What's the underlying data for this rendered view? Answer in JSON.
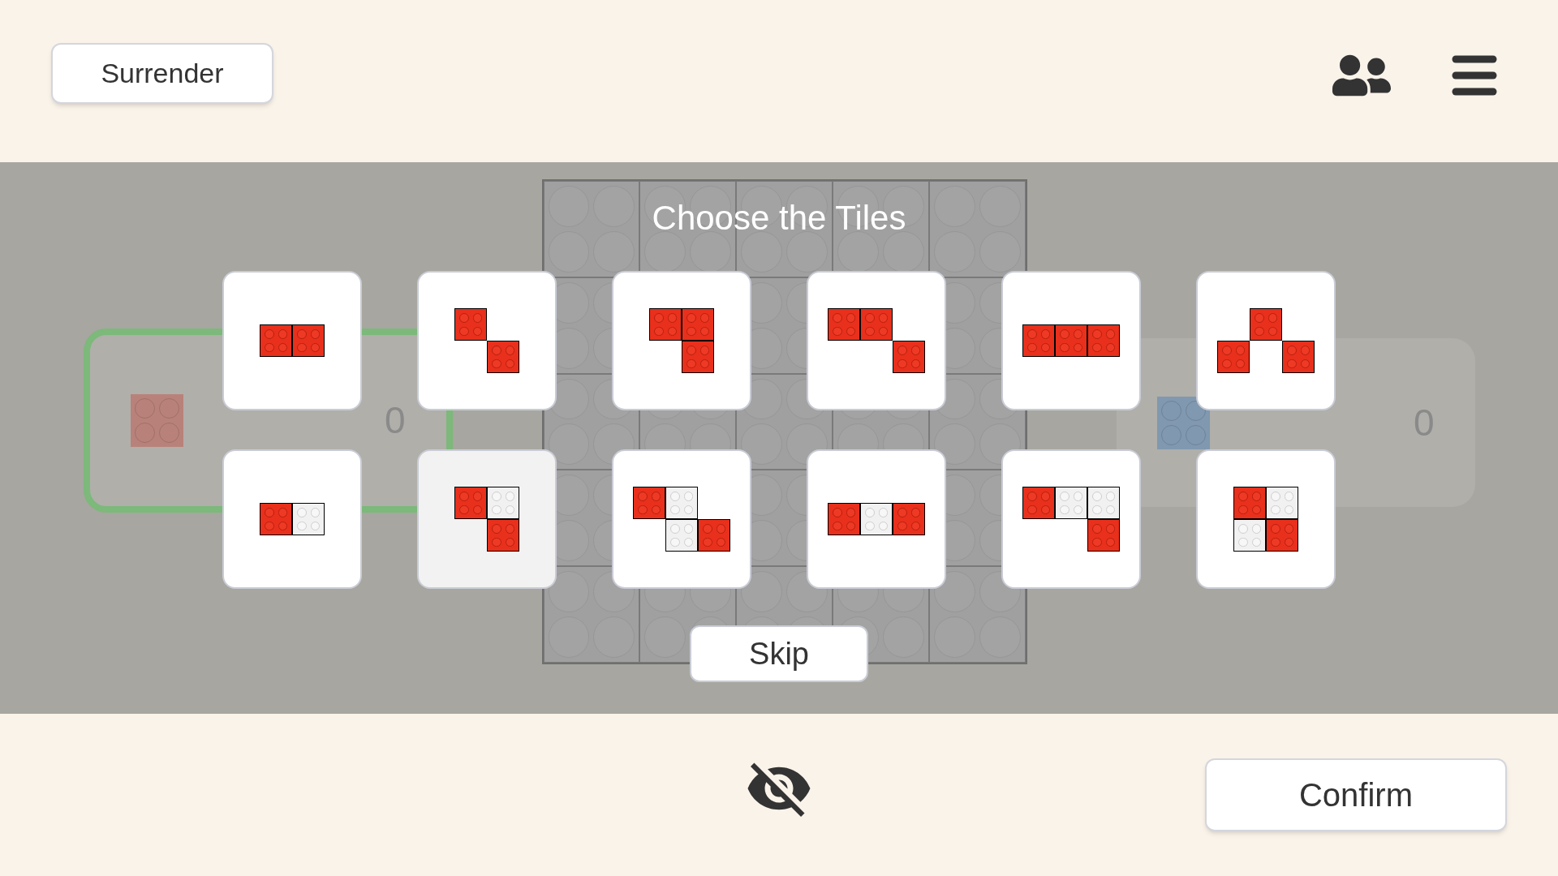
{
  "header": {
    "surrender_button": "Surrender"
  },
  "players": [
    {
      "score": "0",
      "color": "#b8827a",
      "active": true
    },
    {
      "score": "0",
      "color": "#8098b0",
      "active": false
    }
  ],
  "tile_picker": {
    "title": "Choose the Tiles",
    "tiles": [
      {
        "selected": false,
        "rows": [
          [
            {
              "kind": "red"
            },
            {
              "kind": "red"
            }
          ]
        ]
      },
      {
        "selected": false,
        "rows": [
          [
            {
              "kind": "red"
            },
            {
              "kind": "empty"
            }
          ],
          [
            {
              "kind": "empty"
            },
            {
              "kind": "red"
            }
          ]
        ]
      },
      {
        "selected": false,
        "rows": [
          [
            {
              "kind": "red"
            },
            {
              "kind": "red"
            }
          ],
          [
            {
              "kind": "empty"
            },
            {
              "kind": "red"
            }
          ]
        ]
      },
      {
        "selected": false,
        "rows": [
          [
            {
              "kind": "red"
            },
            {
              "kind": "red"
            },
            {
              "kind": "empty"
            }
          ],
          [
            {
              "kind": "empty"
            },
            {
              "kind": "empty"
            },
            {
              "kind": "red"
            }
          ]
        ]
      },
      {
        "selected": false,
        "rows": [
          [
            {
              "kind": "red"
            },
            {
              "kind": "red"
            },
            {
              "kind": "red"
            }
          ]
        ]
      },
      {
        "selected": false,
        "rows": [
          [
            {
              "kind": "empty"
            },
            {
              "kind": "red"
            },
            {
              "kind": "empty"
            }
          ],
          [
            {
              "kind": "red"
            },
            {
              "kind": "empty"
            },
            {
              "kind": "red"
            }
          ]
        ]
      },
      {
        "selected": false,
        "rows": [
          [
            {
              "kind": "red"
            },
            {
              "kind": "white"
            }
          ]
        ]
      },
      {
        "selected": true,
        "rows": [
          [
            {
              "kind": "red"
            },
            {
              "kind": "white"
            }
          ],
          [
            {
              "kind": "empty"
            },
            {
              "kind": "red"
            }
          ]
        ]
      },
      {
        "selected": false,
        "rows": [
          [
            {
              "kind": "red"
            },
            {
              "kind": "white"
            },
            {
              "kind": "empty"
            }
          ],
          [
            {
              "kind": "empty"
            },
            {
              "kind": "white"
            },
            {
              "kind": "red"
            }
          ]
        ]
      },
      {
        "selected": false,
        "rows": [
          [
            {
              "kind": "red"
            },
            {
              "kind": "white"
            },
            {
              "kind": "red"
            }
          ]
        ]
      },
      {
        "selected": false,
        "rows": [
          [
            {
              "kind": "red"
            },
            {
              "kind": "white"
            },
            {
              "kind": "white"
            }
          ],
          [
            {
              "kind": "empty"
            },
            {
              "kind": "empty"
            },
            {
              "kind": "red"
            }
          ]
        ]
      },
      {
        "selected": false,
        "rows": [
          [
            {
              "kind": "red"
            },
            {
              "kind": "white"
            }
          ],
          [
            {
              "kind": "white"
            },
            {
              "kind": "red"
            }
          ]
        ]
      }
    ],
    "skip_button": "Skip"
  },
  "footer": {
    "confirm_button": "Confirm"
  }
}
